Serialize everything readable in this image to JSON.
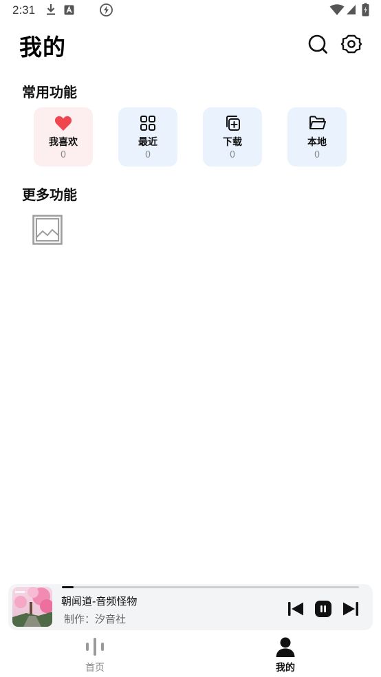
{
  "status_bar": {
    "time": "2:31"
  },
  "header": {
    "title": "我的",
    "search_icon": "search-icon",
    "settings_icon": "gear-icon"
  },
  "common": {
    "title": "常用功能",
    "items": [
      {
        "label": "我喜欢",
        "count": "0",
        "icon": "heart-icon",
        "bg": "#fdeef0",
        "icon_color": "#f0474f"
      },
      {
        "label": "最近",
        "count": "0",
        "icon": "grid-icon",
        "bg": "#eaf3fd",
        "icon_color": "#111111"
      },
      {
        "label": "下载",
        "count": "0",
        "icon": "download-copy-icon",
        "bg": "#eaf3fd",
        "icon_color": "#111111"
      },
      {
        "label": "本地",
        "count": "0",
        "icon": "folder-icon",
        "bg": "#eaf3fd",
        "icon_color": "#111111"
      }
    ]
  },
  "more": {
    "title": "更多功能",
    "icon": "image-placeholder-icon"
  },
  "player": {
    "title": "朝闻道-音频怪物",
    "author": "制作：汐音社",
    "progress": 0.04,
    "prev_icon": "skip-previous-icon",
    "pause_icon": "pause-icon",
    "next_icon": "skip-next-icon"
  },
  "tabs": [
    {
      "label": "首页",
      "icon": "audio-bars-icon",
      "active": false
    },
    {
      "label": "我的",
      "icon": "person-icon",
      "active": true
    }
  ],
  "colors": {
    "accent": "#f0474f",
    "card_blue": "#eaf3fd",
    "card_pink": "#fdeef0",
    "inactive": "#9a9a9a"
  }
}
